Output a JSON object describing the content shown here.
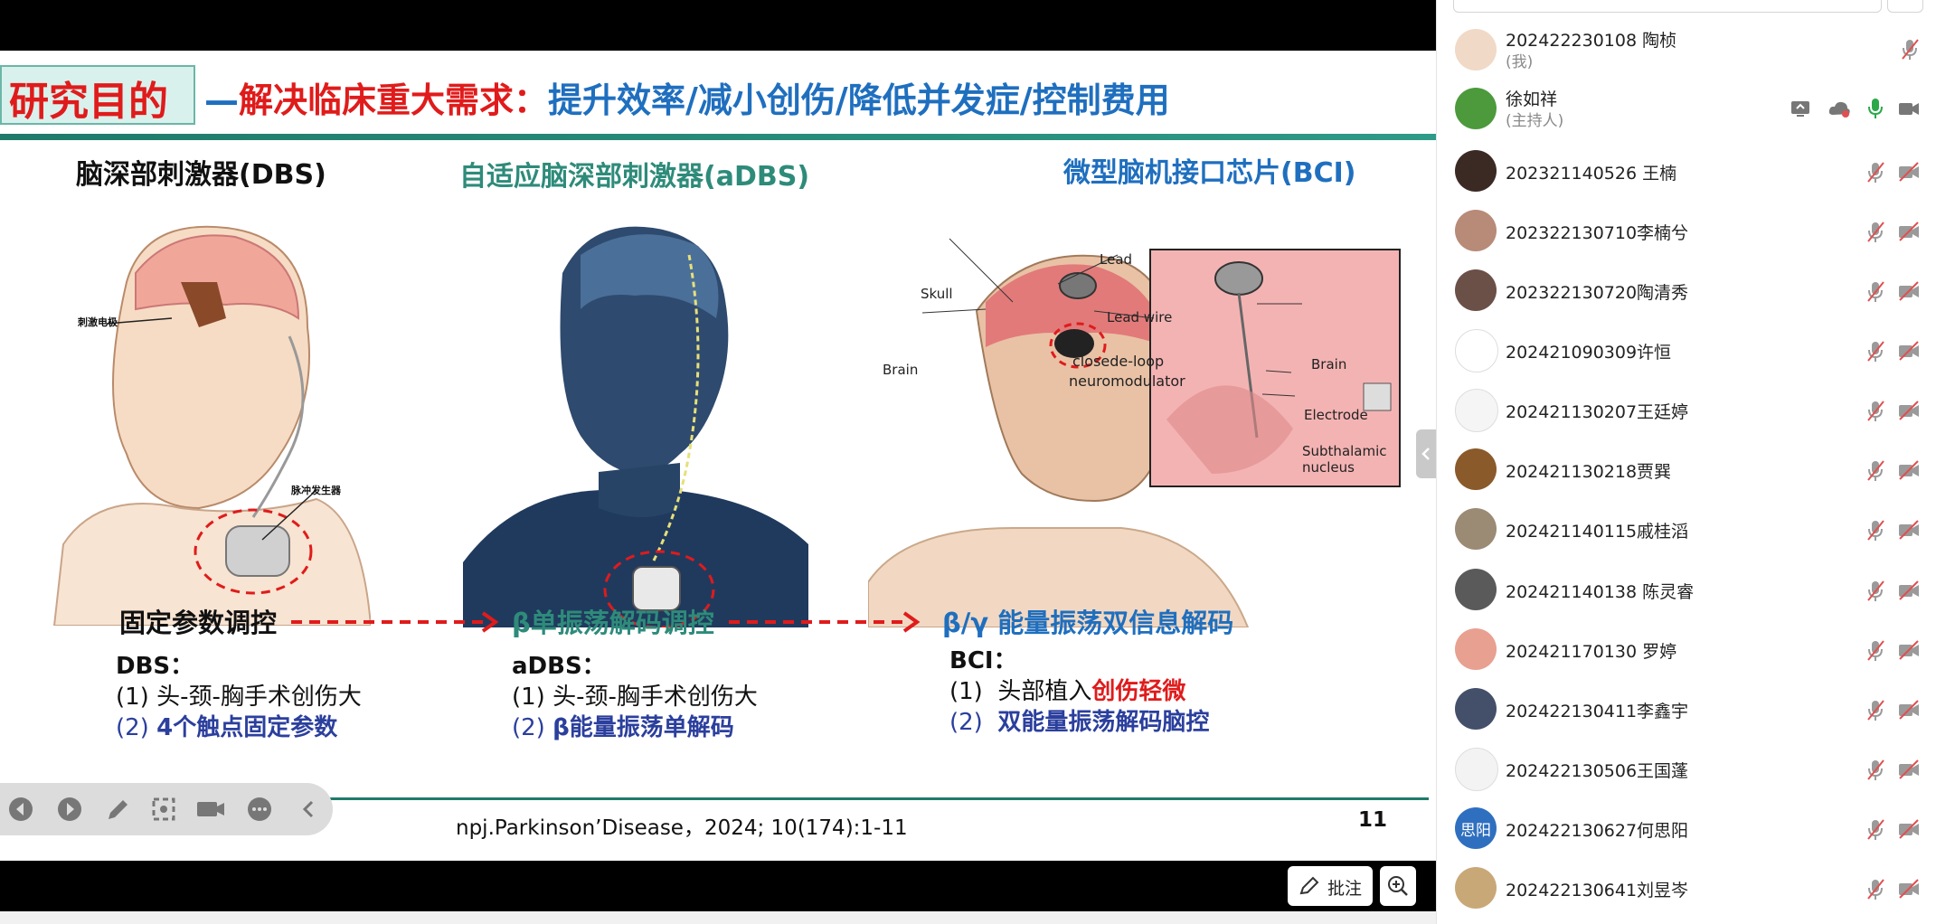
{
  "slide": {
    "title_box": "研究目的",
    "headline_dash": "—",
    "headline_red": "解决临床重大需求：",
    "headline_blue": "提升效率/减小创伤/降低并发症/控制费用",
    "col1_title": "脑深部刺激器(DBS)",
    "col2_title": "自适应脑深部刺激器(aDBS)",
    "col3_title": "微型脑机接口芯片(BCI)",
    "img1_label_a": "刺激电极",
    "img1_label_b": "脉冲发生器",
    "img3_labels": {
      "skull": "Skull",
      "brain": "Brain",
      "lead": "Lead",
      "lead_wire": "Lead wire",
      "closed_loop": "closede-loop",
      "neuromodulator": "neuromodulator",
      "brain2": "Brain",
      "electrode": "Electrode",
      "subthalamic": "Subthalamic",
      "nucleus": "nucleus"
    },
    "flow": {
      "step1": "固定参数调控",
      "step2": "β单振荡解码调控",
      "step3": "β/γ 能量振荡双信息解码"
    },
    "dbs": {
      "head": "DBS：",
      "line1": "(1) 头-颈-胸手术创伤大",
      "line2_num": "(2)",
      "line2": "4个触点固定参数"
    },
    "adbs": {
      "head": "aDBS：",
      "line1": "(1) 头-颈-胸手术创伤大",
      "line2_num": "(2)",
      "line2": "β能量振荡单解码"
    },
    "bci": {
      "head": "BCI：",
      "line1_num": "(1)",
      "line1_a": "头部植入",
      "line1_b": "创伤轻微",
      "line2_num": "(2)",
      "line2": "双能量振荡解码脑控"
    },
    "citation": "npj.Parkinson’Disease，2024; 10(174):1-11",
    "page_number": "11"
  },
  "controls": {
    "annotate_label": "批注",
    "icons": [
      "prev-icon",
      "next-icon",
      "pen-icon",
      "screenshot-icon",
      "camera-icon",
      "more-icon",
      "collapse-left-icon"
    ]
  },
  "participants": [
    {
      "name": "202422230108 陶桢",
      "sub": "(我)",
      "avatar_color": "#f0d9c6"
    },
    {
      "name": "徐如祥",
      "sub": "(主持人)",
      "avatar_color": "#4c9a3b",
      "host": true
    },
    {
      "name": "202321140526 王楠",
      "avatar_color": "#3b2a24"
    },
    {
      "name": "202322130710李楠兮",
      "avatar_color": "#b88a78"
    },
    {
      "name": "202322130720陶清秀",
      "avatar_color": "#6b5048"
    },
    {
      "name": "202421090309许恒",
      "avatar_color": "#ffffff"
    },
    {
      "name": "202421130207王廷婷",
      "avatar_color": "#f5f5f5"
    },
    {
      "name": "202421130218贾巽",
      "avatar_color": "#8a5a2a"
    },
    {
      "name": "202421140115戚桂滔",
      "avatar_color": "#9b8a74"
    },
    {
      "name": "202421140138 陈灵睿",
      "avatar_color": "#5a5a5a"
    },
    {
      "name": "202421170130 罗婷",
      "avatar_color": "#e8a090"
    },
    {
      "name": "202422130411李鑫宇",
      "avatar_color": "#44506a"
    },
    {
      "name": "202422130506王国蓬",
      "avatar_color": "#f3f3f3"
    },
    {
      "name": "202422130627何思阳",
      "avatar_text": "思阳",
      "avatar_color": "#2f6fbf"
    },
    {
      "name": "202422130641刘昱岑",
      "avatar_color": "#c9a878"
    }
  ],
  "colors": {
    "accent_red": "#e01b1b",
    "accent_blue": "#1f6fbf",
    "teal": "#2e8b7a",
    "muted_icon": "#9a9a9a",
    "mic_green": "#2aa84a"
  }
}
